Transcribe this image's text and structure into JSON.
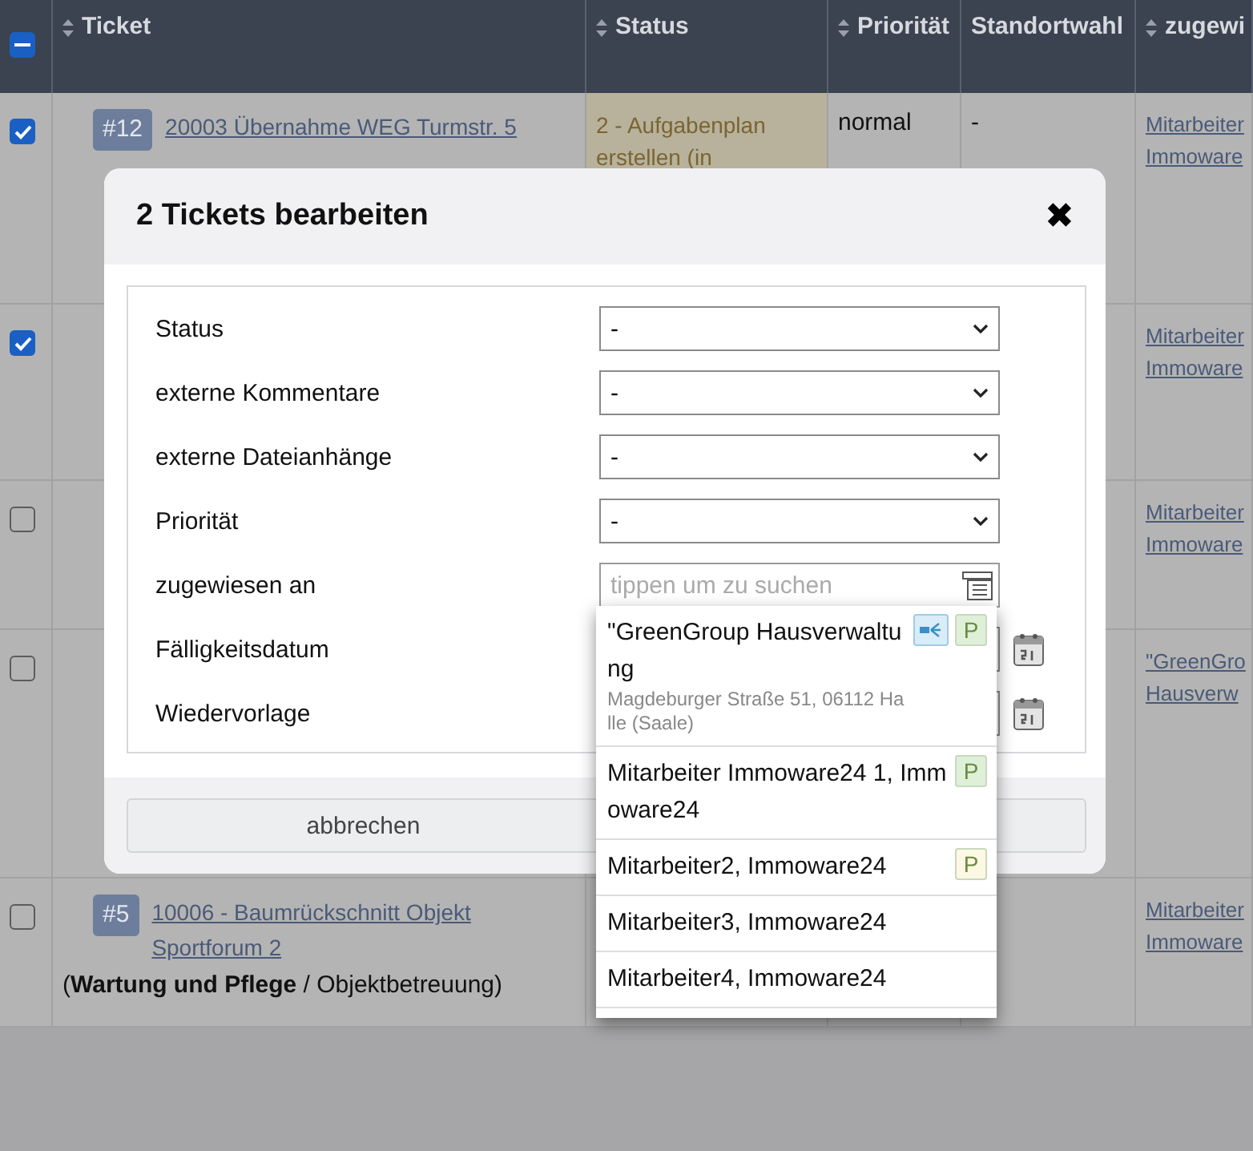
{
  "table": {
    "select_all": {
      "indeterminate": true
    },
    "columns": [
      {
        "label": "Ticket",
        "sortable": true
      },
      {
        "label": "Status",
        "sortable": true
      },
      {
        "label": "Priorität",
        "sortable": true
      },
      {
        "label": "Standortwahl",
        "sortable": false
      },
      {
        "label": "zugewi",
        "sortable": true
      }
    ],
    "rows": [
      {
        "checked": true,
        "badge": "#12",
        "title": "20003 Übernahme WEG Turmstr. 5",
        "status": "2 - Aufgabenplan erstellen (in",
        "priority": "normal",
        "location": "-",
        "assignee": "Mitarbeiter Immoware"
      },
      {
        "checked": true,
        "assignee": "Mitarbeiter Immoware"
      },
      {
        "checked": false,
        "assignee": "Mitarbeiter Immoware"
      },
      {
        "checked": false,
        "assignee": "\"GreenGro Hausverw"
      },
      {
        "checked": false,
        "badge": "#5",
        "title": "10006 - Baumrückschnitt Objekt Sportforum 2",
        "category": "(**Wartung und Pflege** / Objektbetreuung)",
        "assignee": "Mitarbeiter Immoware"
      }
    ]
  },
  "dialog": {
    "title": "2 Tickets bearbeiten",
    "close": "✖",
    "fields": [
      {
        "kind": "select",
        "label": "Status",
        "value": "-"
      },
      {
        "kind": "select",
        "label": "externe Kommentare",
        "value": "-"
      },
      {
        "kind": "select",
        "label": "externe Dateianhänge",
        "value": "-"
      },
      {
        "kind": "select",
        "label": "Priorität",
        "value": "-"
      },
      {
        "kind": "search",
        "label": "zugewiesen an",
        "placeholder": "tippen um zu suchen",
        "suggestions": [
          {
            "name": "\"GreenGroup Hausverwaltung",
            "address": "Magdeburger Straße 51, 06112 Halle (Saale)",
            "tags": [
              {
                "kind": "icon",
                "color": "#d9ecf8"
              },
              {
                "kind": "text",
                "text": "P",
                "color": "#dff0d8"
              }
            ]
          },
          {
            "name": "Mitarbeiter Immoware24 1, Immoware24",
            "tags": [
              {
                "kind": "text",
                "text": "P",
                "color": "#dff0d8"
              }
            ]
          },
          {
            "name": "Mitarbeiter2, Immoware24",
            "tags": [
              {
                "kind": "text",
                "text": "P",
                "color": "#fcf8e3"
              }
            ]
          },
          {
            "name": "Mitarbeiter3, Immoware24"
          },
          {
            "name": "Mitarbeiter4, Immoware24"
          }
        ]
      },
      {
        "kind": "date",
        "label": "Fälligkeitsdatum"
      },
      {
        "kind": "date",
        "label": "Wiedervorlage"
      }
    ],
    "buttons": [
      "abbrechen"
    ]
  }
}
